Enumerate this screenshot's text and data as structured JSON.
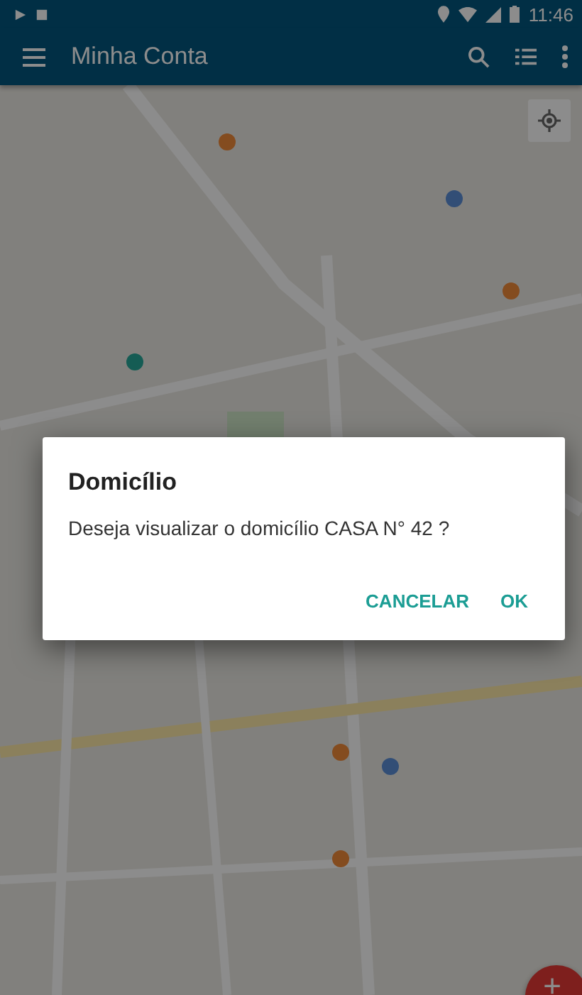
{
  "status_bar": {
    "time": "11:46"
  },
  "app_bar": {
    "title": "Minha Conta"
  },
  "dialog": {
    "title": "Domicílio",
    "message": "Deseja visualizar o domicílio CASA N° 42 ?",
    "buttons": [
      "CANCELAR",
      "OK"
    ]
  },
  "fab": {
    "label": "+"
  }
}
